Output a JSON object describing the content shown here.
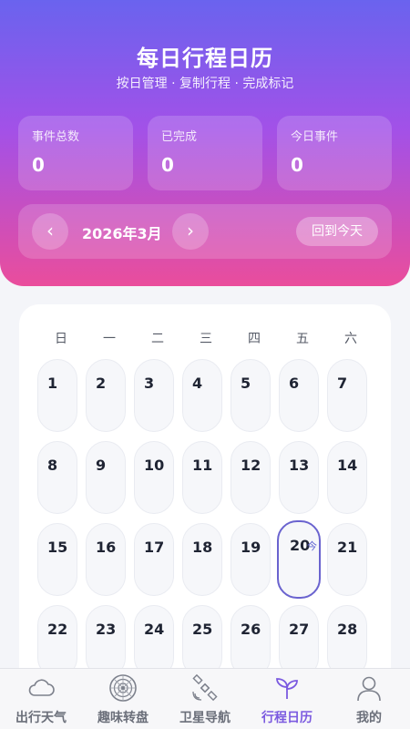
{
  "header": {
    "title": "每日行程日历",
    "subtitle": "按日管理 · 复制行程 · 完成标记"
  },
  "stats": [
    {
      "label": "事件总数",
      "value": "0"
    },
    {
      "label": "已完成",
      "value": "0"
    },
    {
      "label": "今日事件",
      "value": "0"
    }
  ],
  "month_nav": {
    "prev_icon": "chevron-left-icon",
    "prev_glyph": "‹",
    "current_month": "2026年3月",
    "next_icon": "chevron-right-icon",
    "next_glyph": "›",
    "today_button": "回到今天"
  },
  "calendar": {
    "weekdays": [
      "日",
      "一",
      "二",
      "三",
      "四",
      "五",
      "六"
    ],
    "days": [
      "1",
      "2",
      "3",
      "4",
      "5",
      "6",
      "7",
      "8",
      "9",
      "10",
      "11",
      "12",
      "13",
      "14",
      "15",
      "16",
      "17",
      "18",
      "19",
      "20",
      "21",
      "22",
      "23",
      "24",
      "25",
      "26",
      "27",
      "28"
    ],
    "today": "20",
    "today_mark": "今"
  },
  "tabs": [
    {
      "label": "出行天气",
      "icon": "cloud-icon",
      "active": false
    },
    {
      "label": "趣味转盘",
      "icon": "wheel-icon",
      "active": false
    },
    {
      "label": "卫星导航",
      "icon": "satellite-icon",
      "active": false
    },
    {
      "label": "行程日历",
      "icon": "sprout-icon",
      "active": true
    },
    {
      "label": "我的",
      "icon": "user-icon",
      "active": false
    }
  ],
  "colors": {
    "gradient_top": "#6a63ee",
    "gradient_mid": "#a251e8",
    "gradient_bottom": "#ea4d9c",
    "active_tab": "#7b5ae0",
    "today_ring": "#6a63cf"
  }
}
